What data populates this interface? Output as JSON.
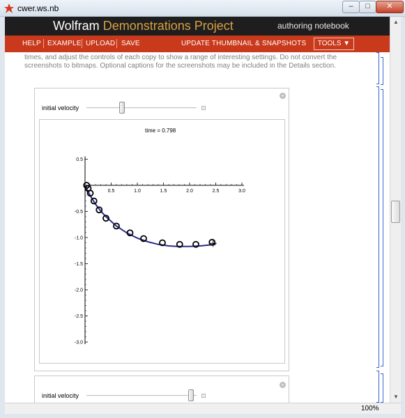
{
  "window": {
    "title": "cwer.ws.nb",
    "minimize_label": "–",
    "maximize_label": "□",
    "close_label": "✕"
  },
  "wolfram_bar": {
    "brand": "Wolfram",
    "brand_accent": "Demonstrations Project",
    "authoring": "authoring notebook"
  },
  "nav": {
    "help": "HELP",
    "example": "EXAMPLE",
    "upload": "UPLOAD",
    "save": "SAVE",
    "update": "UPDATE THUMBNAIL & SNAPSHOTS",
    "tools": "TOOLS ▼"
  },
  "instructions": "times, and adjust the controls of each copy to show a range of interesting settings. Do not convert the screenshots to bitmaps. Optional captions for the screenshots may be included in the Details section.",
  "panel1": {
    "control_label": "initial velocity",
    "slider_fraction": 0.31,
    "time_label": "time = 0.798"
  },
  "panel2": {
    "control_label": "initial velocity",
    "slider_fraction": 0.97
  },
  "zoom": "100%",
  "colors": {
    "brand_orange": "#d9a043",
    "nav_red": "#c9391c",
    "curve_blue": "#2b2b8f"
  },
  "chart_data": {
    "type": "scatter",
    "title": "",
    "xlabel": "",
    "ylabel": "",
    "xlim": [
      0,
      3.0
    ],
    "ylim": [
      -3.0,
      0.5
    ],
    "x_ticks": [
      0.5,
      1.0,
      1.5,
      2.0,
      2.5,
      3.0
    ],
    "x_tick_labels": [
      "0.5",
      "1.0",
      "1.5",
      "2.0",
      "2.5",
      "3.0"
    ],
    "y_ticks": [
      0.5,
      -0.5,
      -1.0,
      -1.5,
      -2.0,
      -2.5,
      -3.0
    ],
    "y_tick_labels": [
      "0.5",
      "−0.5",
      "−1.0",
      "−1.5",
      "−2.0",
      "−2.5",
      "−3.0"
    ],
    "curve": {
      "x": [
        0,
        0.1,
        0.2,
        0.3,
        0.4,
        0.6,
        0.8,
        1.0,
        1.2,
        1.4,
        1.6,
        1.8,
        2.0,
        2.2,
        2.4,
        2.5
      ],
      "y": [
        0,
        -0.2,
        -0.36,
        -0.49,
        -0.6,
        -0.78,
        -0.91,
        -1.01,
        -1.08,
        -1.13,
        -1.16,
        -1.17,
        -1.17,
        -1.16,
        -1.14,
        -1.13
      ]
    },
    "points": {
      "x": [
        0.03,
        0.06,
        0.1,
        0.17,
        0.27,
        0.4,
        0.6,
        0.86,
        1.12,
        1.48,
        1.81,
        2.12,
        2.43
      ],
      "y": [
        0.0,
        -0.06,
        -0.15,
        -0.3,
        -0.47,
        -0.63,
        -0.78,
        -0.91,
        -1.02,
        -1.1,
        -1.13,
        -1.13,
        -1.09
      ]
    },
    "marker": {
      "x": 2.45,
      "y": -1.11
    }
  }
}
